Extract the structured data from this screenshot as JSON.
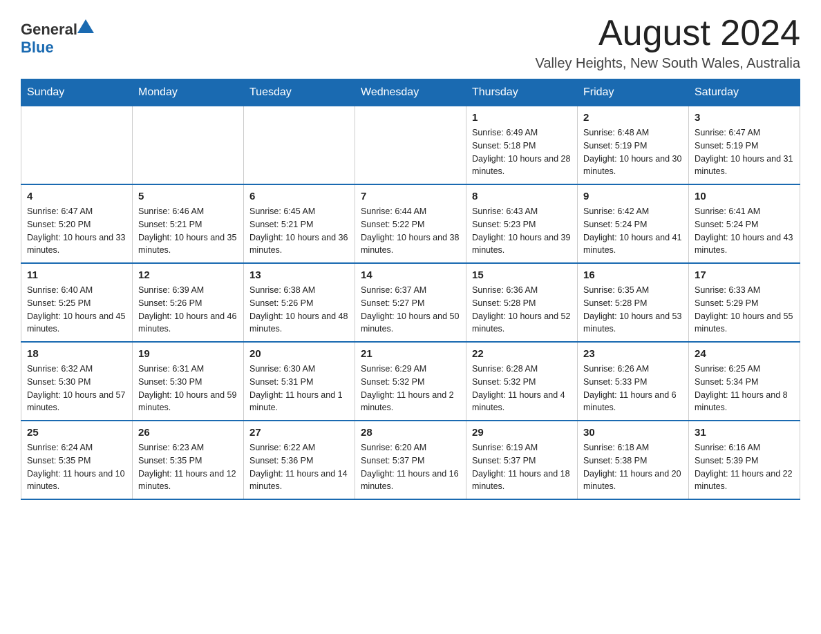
{
  "logo": {
    "text_general": "General",
    "text_blue": "Blue"
  },
  "title": "August 2024",
  "subtitle": "Valley Heights, New South Wales, Australia",
  "headers": [
    "Sunday",
    "Monday",
    "Tuesday",
    "Wednesday",
    "Thursday",
    "Friday",
    "Saturday"
  ],
  "weeks": [
    [
      {
        "day": "",
        "info": ""
      },
      {
        "day": "",
        "info": ""
      },
      {
        "day": "",
        "info": ""
      },
      {
        "day": "",
        "info": ""
      },
      {
        "day": "1",
        "info": "Sunrise: 6:49 AM\nSunset: 5:18 PM\nDaylight: 10 hours and 28 minutes."
      },
      {
        "day": "2",
        "info": "Sunrise: 6:48 AM\nSunset: 5:19 PM\nDaylight: 10 hours and 30 minutes."
      },
      {
        "day": "3",
        "info": "Sunrise: 6:47 AM\nSunset: 5:19 PM\nDaylight: 10 hours and 31 minutes."
      }
    ],
    [
      {
        "day": "4",
        "info": "Sunrise: 6:47 AM\nSunset: 5:20 PM\nDaylight: 10 hours and 33 minutes."
      },
      {
        "day": "5",
        "info": "Sunrise: 6:46 AM\nSunset: 5:21 PM\nDaylight: 10 hours and 35 minutes."
      },
      {
        "day": "6",
        "info": "Sunrise: 6:45 AM\nSunset: 5:21 PM\nDaylight: 10 hours and 36 minutes."
      },
      {
        "day": "7",
        "info": "Sunrise: 6:44 AM\nSunset: 5:22 PM\nDaylight: 10 hours and 38 minutes."
      },
      {
        "day": "8",
        "info": "Sunrise: 6:43 AM\nSunset: 5:23 PM\nDaylight: 10 hours and 39 minutes."
      },
      {
        "day": "9",
        "info": "Sunrise: 6:42 AM\nSunset: 5:24 PM\nDaylight: 10 hours and 41 minutes."
      },
      {
        "day": "10",
        "info": "Sunrise: 6:41 AM\nSunset: 5:24 PM\nDaylight: 10 hours and 43 minutes."
      }
    ],
    [
      {
        "day": "11",
        "info": "Sunrise: 6:40 AM\nSunset: 5:25 PM\nDaylight: 10 hours and 45 minutes."
      },
      {
        "day": "12",
        "info": "Sunrise: 6:39 AM\nSunset: 5:26 PM\nDaylight: 10 hours and 46 minutes."
      },
      {
        "day": "13",
        "info": "Sunrise: 6:38 AM\nSunset: 5:26 PM\nDaylight: 10 hours and 48 minutes."
      },
      {
        "day": "14",
        "info": "Sunrise: 6:37 AM\nSunset: 5:27 PM\nDaylight: 10 hours and 50 minutes."
      },
      {
        "day": "15",
        "info": "Sunrise: 6:36 AM\nSunset: 5:28 PM\nDaylight: 10 hours and 52 minutes."
      },
      {
        "day": "16",
        "info": "Sunrise: 6:35 AM\nSunset: 5:28 PM\nDaylight: 10 hours and 53 minutes."
      },
      {
        "day": "17",
        "info": "Sunrise: 6:33 AM\nSunset: 5:29 PM\nDaylight: 10 hours and 55 minutes."
      }
    ],
    [
      {
        "day": "18",
        "info": "Sunrise: 6:32 AM\nSunset: 5:30 PM\nDaylight: 10 hours and 57 minutes."
      },
      {
        "day": "19",
        "info": "Sunrise: 6:31 AM\nSunset: 5:30 PM\nDaylight: 10 hours and 59 minutes."
      },
      {
        "day": "20",
        "info": "Sunrise: 6:30 AM\nSunset: 5:31 PM\nDaylight: 11 hours and 1 minute."
      },
      {
        "day": "21",
        "info": "Sunrise: 6:29 AM\nSunset: 5:32 PM\nDaylight: 11 hours and 2 minutes."
      },
      {
        "day": "22",
        "info": "Sunrise: 6:28 AM\nSunset: 5:32 PM\nDaylight: 11 hours and 4 minutes."
      },
      {
        "day": "23",
        "info": "Sunrise: 6:26 AM\nSunset: 5:33 PM\nDaylight: 11 hours and 6 minutes."
      },
      {
        "day": "24",
        "info": "Sunrise: 6:25 AM\nSunset: 5:34 PM\nDaylight: 11 hours and 8 minutes."
      }
    ],
    [
      {
        "day": "25",
        "info": "Sunrise: 6:24 AM\nSunset: 5:35 PM\nDaylight: 11 hours and 10 minutes."
      },
      {
        "day": "26",
        "info": "Sunrise: 6:23 AM\nSunset: 5:35 PM\nDaylight: 11 hours and 12 minutes."
      },
      {
        "day": "27",
        "info": "Sunrise: 6:22 AM\nSunset: 5:36 PM\nDaylight: 11 hours and 14 minutes."
      },
      {
        "day": "28",
        "info": "Sunrise: 6:20 AM\nSunset: 5:37 PM\nDaylight: 11 hours and 16 minutes."
      },
      {
        "day": "29",
        "info": "Sunrise: 6:19 AM\nSunset: 5:37 PM\nDaylight: 11 hours and 18 minutes."
      },
      {
        "day": "30",
        "info": "Sunrise: 6:18 AM\nSunset: 5:38 PM\nDaylight: 11 hours and 20 minutes."
      },
      {
        "day": "31",
        "info": "Sunrise: 6:16 AM\nSunset: 5:39 PM\nDaylight: 11 hours and 22 minutes."
      }
    ]
  ]
}
